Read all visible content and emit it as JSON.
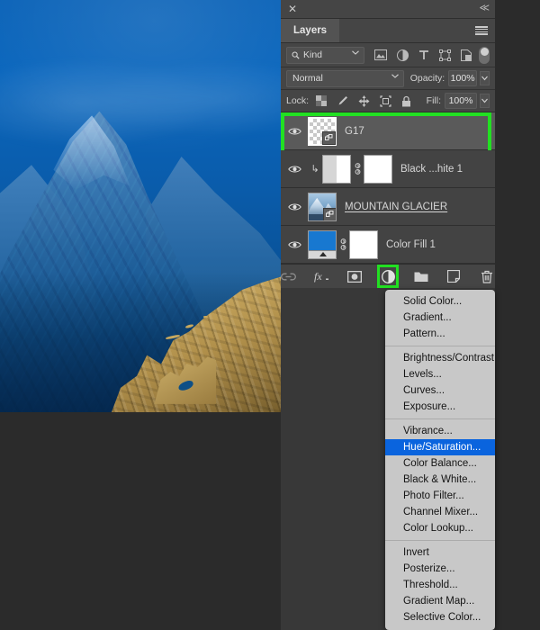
{
  "app": {
    "panel_title": "Layers",
    "close_icon": "close-icon",
    "collapse_icon": "collapse-double-chevron-icon",
    "panel_menu_icon": "hamburger-menu-icon"
  },
  "filter_bar": {
    "kind_label": "Kind",
    "search_icon": "search-icon",
    "chevron_icon": "chevron-down-icon",
    "filter_icons": [
      {
        "name": "filter-pixel-icon",
        "label": "Pixel layers"
      },
      {
        "name": "filter-adjustment-icon",
        "label": "Adjustment layers"
      },
      {
        "name": "filter-type-icon",
        "label": "Type layers"
      },
      {
        "name": "filter-shape-icon",
        "label": "Shape layers"
      },
      {
        "name": "filter-smartobject-icon",
        "label": "Smart objects"
      }
    ],
    "toggle_name": "filter-enable-toggle"
  },
  "blend_bar": {
    "blend_mode": "Normal",
    "opacity_label": "Opacity:",
    "opacity_value": "100%"
  },
  "lock_bar": {
    "lock_label": "Lock:",
    "fill_label": "Fill:",
    "fill_value": "100%",
    "lock_icons": [
      {
        "name": "lock-transparent-pixels-icon"
      },
      {
        "name": "lock-image-pixels-icon"
      },
      {
        "name": "lock-position-icon"
      },
      {
        "name": "lock-artboard-nesting-icon"
      },
      {
        "name": "lock-all-icon"
      }
    ]
  },
  "layers": [
    {
      "name": "G17",
      "visible": true,
      "selected": true,
      "thumb": "transparent-checker-smart-object",
      "underlined": false,
      "has_mask": false,
      "has_link": false,
      "clipped": false
    },
    {
      "name": "Black ...hite 1",
      "visible": true,
      "selected": false,
      "thumb": "black-and-white-adjustment",
      "underlined": false,
      "has_mask": true,
      "has_link": true,
      "clipped": true
    },
    {
      "name": "MOUNTAIN GLACIER",
      "visible": true,
      "selected": false,
      "thumb": "mountain-photo-smart-object",
      "underlined": true,
      "has_mask": false,
      "has_link": false,
      "clipped": false
    },
    {
      "name": "Color Fill 1",
      "visible": true,
      "selected": false,
      "thumb": "solid-color-fill-blue",
      "underlined": false,
      "has_mask": true,
      "has_link": true,
      "clipped": false
    }
  ],
  "bottom_bar": [
    {
      "name": "link-layers-button",
      "label": "Link layers",
      "highlighted": false
    },
    {
      "name": "layer-style-button",
      "label": "Add a layer style",
      "highlighted": false
    },
    {
      "name": "add-layer-mask-button",
      "label": "Add layer mask",
      "highlighted": false
    },
    {
      "name": "new-adjustment-layer-button",
      "label": "Create new fill or adjustment layer",
      "highlighted": true
    },
    {
      "name": "new-group-button",
      "label": "Create a new group",
      "highlighted": false
    },
    {
      "name": "new-layer-button",
      "label": "Create a new layer",
      "highlighted": false
    },
    {
      "name": "delete-layer-button",
      "label": "Delete layer",
      "highlighted": false
    }
  ],
  "context_menu": {
    "groups": [
      [
        "Solid Color...",
        "Gradient...",
        "Pattern..."
      ],
      [
        "Brightness/Contrast...",
        "Levels...",
        "Curves...",
        "Exposure..."
      ],
      [
        "Vibrance...",
        "Hue/Saturation...",
        "Color Balance...",
        "Black & White...",
        "Photo Filter...",
        "Channel Mixer...",
        "Color Lookup..."
      ],
      [
        "Invert",
        "Posterize...",
        "Threshold...",
        "Gradient Map...",
        "Selective Color..."
      ]
    ],
    "highlighted_item": "Hue/Saturation..."
  },
  "colors": {
    "highlight_green": "#22e022",
    "menu_selection_blue": "#0a64de",
    "panel_background": "#383838",
    "canvas_blue": "#0a5cab",
    "canvas_gold": "#c8a860"
  }
}
